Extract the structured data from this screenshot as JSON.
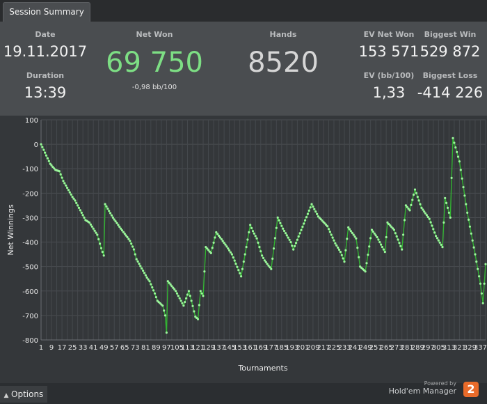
{
  "tab": {
    "label": "Session Summary"
  },
  "summary": {
    "date_label": "Date",
    "date_value": "19.11.2017",
    "duration_label": "Duration",
    "duration_value": "13:39",
    "netwon_label": "Net Won",
    "netwon_value": "69 750",
    "netwon_sub": "-0,98 bb/100",
    "hands_label": "Hands",
    "hands_value": "8520",
    "ev_label": "EV Net Won",
    "ev_value": "153 571",
    "evbb_label": "EV (bb/100)",
    "evbb_value": "1,33",
    "biggestwin_label": "Biggest Win",
    "biggestwin_value": "529 872",
    "biggestloss_label": "Biggest Loss",
    "biggestloss_value": "-414 226"
  },
  "colors": {
    "accent_green": "#7dde84",
    "line_green": "#32b432",
    "point_green": "#9bf59b"
  },
  "chart_data": {
    "type": "line",
    "xlabel": "Tournaments",
    "ylabel": "Net Winnings",
    "ylim": [
      -800,
      100
    ],
    "xlim": [
      1,
      341
    ],
    "yticks": [
      100,
      0,
      -100,
      -200,
      -300,
      -400,
      -500,
      -600,
      -700,
      -800
    ],
    "xticks": [
      1,
      9,
      17,
      25,
      33,
      41,
      49,
      57,
      65,
      73,
      81,
      89,
      97,
      105,
      113,
      121,
      129,
      137,
      145,
      153,
      161,
      169,
      177,
      185,
      193,
      201,
      209,
      217,
      225,
      233,
      241,
      249,
      257,
      265,
      273,
      281,
      289,
      297,
      305,
      313,
      321,
      329,
      337
    ],
    "grid": true,
    "legend": "none",
    "series": [
      {
        "x": [
          1,
          8,
          12,
          15,
          18,
          25,
          27,
          35,
          38,
          44,
          47,
          49,
          50,
          56,
          62,
          67,
          69,
          72,
          74,
          82,
          84,
          88,
          90,
          94,
          96,
          97,
          98,
          104,
          110,
          114,
          116,
          119,
          121,
          123,
          125,
          127,
          131,
          135,
          142,
          147,
          154,
          161,
          163,
          166,
          170,
          172,
          177,
          182,
          186,
          192,
          194,
          208,
          213,
          220,
          226,
          230,
          233,
          236,
          242,
          245,
          249,
          254,
          258,
          261,
          264,
          266,
          271,
          274,
          277,
          280,
          283,
          287,
          292,
          298,
          303,
          308,
          310,
          314,
          316,
          321,
          327,
          333,
          337,
          339,
          341
        ],
        "y": [
          0,
          -80,
          -105,
          -110,
          -150,
          -215,
          -230,
          -310,
          -320,
          -370,
          -425,
          -455,
          -245,
          -300,
          -345,
          -380,
          -395,
          -430,
          -470,
          -545,
          -560,
          -610,
          -640,
          -660,
          -700,
          -770,
          -560,
          -600,
          -660,
          -600,
          -640,
          -705,
          -715,
          -600,
          -620,
          -420,
          -445,
          -360,
          -410,
          -450,
          -540,
          -330,
          -355,
          -385,
          -455,
          -475,
          -510,
          -300,
          -345,
          -400,
          -430,
          -245,
          -295,
          -335,
          -405,
          -440,
          -480,
          -340,
          -385,
          -500,
          -520,
          -350,
          -380,
          -410,
          -440,
          -320,
          -350,
          -390,
          -430,
          -250,
          -270,
          -185,
          -260,
          -305,
          -375,
          -420,
          -220,
          -300,
          25,
          -70,
          -280,
          -450,
          -570,
          -650,
          -490
        ]
      }
    ]
  },
  "footer": {
    "options_label": "Options",
    "powered_by": "Powered by",
    "brand": "Hold'em Manager",
    "logo_text": "2"
  }
}
